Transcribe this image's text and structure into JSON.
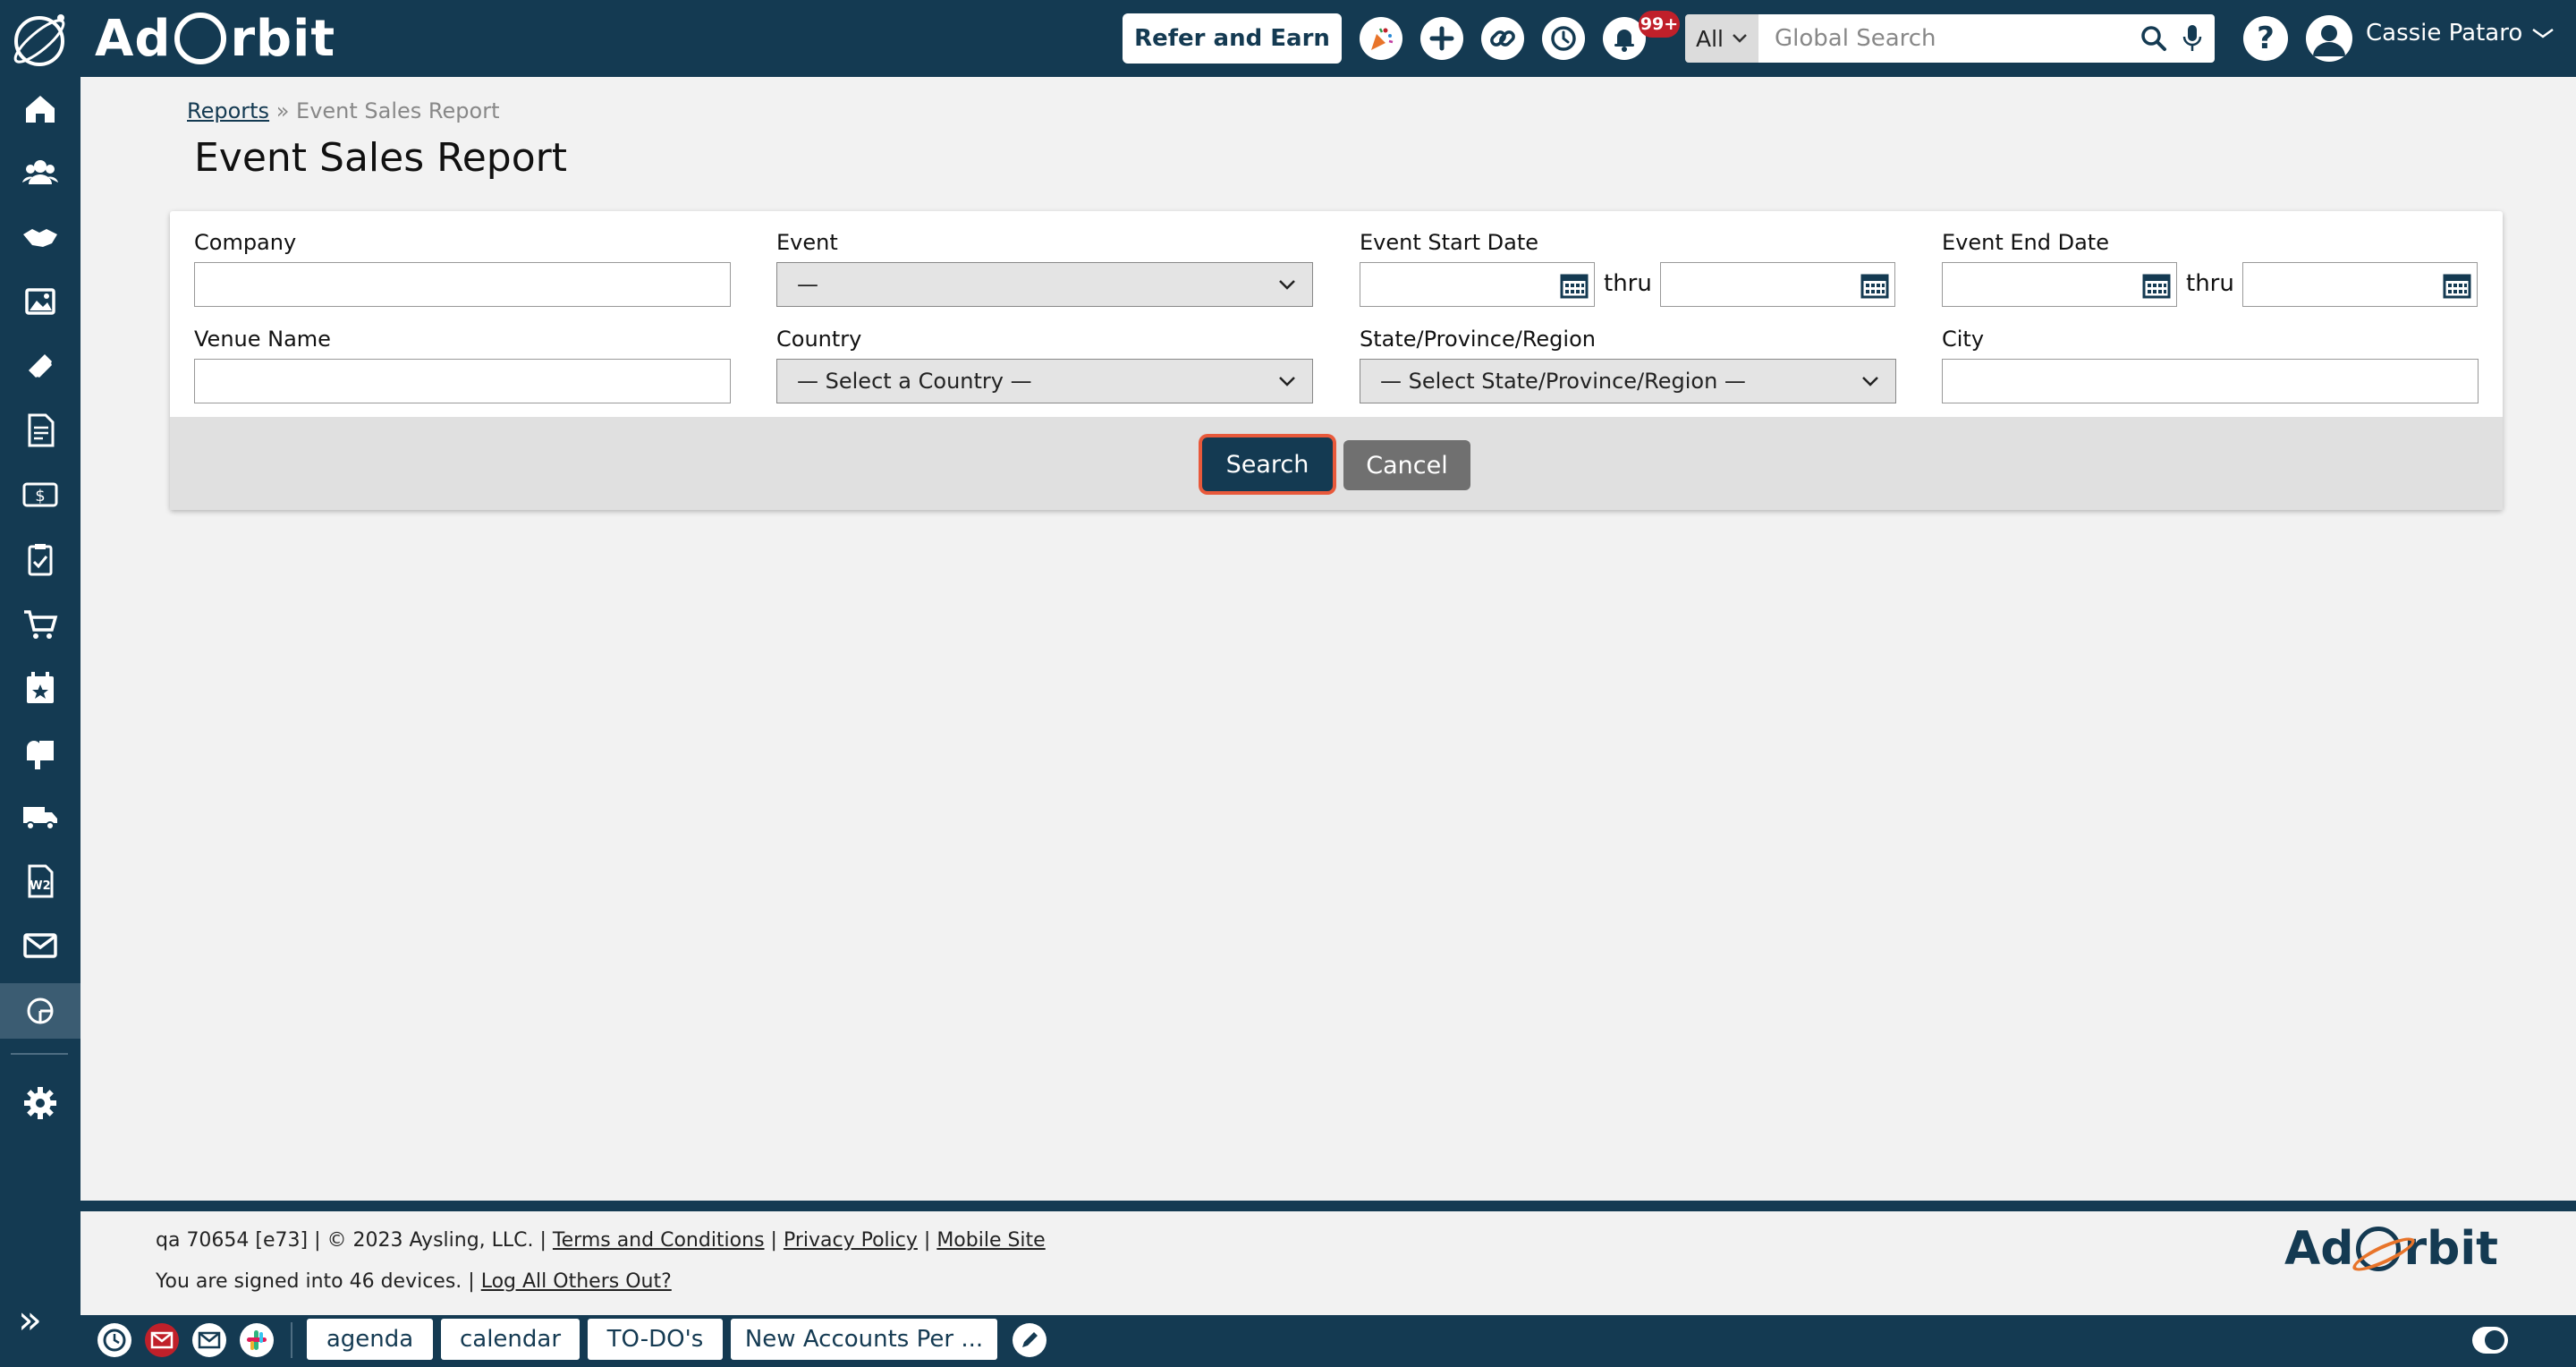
{
  "header": {
    "brand": "Ad Orbit",
    "refer_label": "Refer and Earn",
    "notification_count": "99+",
    "search_scope": "All",
    "search_placeholder": "Global Search",
    "help_label": "?",
    "user_name": "Cassie Pataro"
  },
  "breadcrumb": {
    "parent": "Reports",
    "separator": "»",
    "current": "Event Sales Report"
  },
  "page_title": "Event Sales Report",
  "form": {
    "company_label": "Company",
    "event_label": "Event",
    "event_value": "—",
    "event_start_label": "Event Start Date",
    "event_end_label": "Event End Date",
    "thru_label": "thru",
    "venue_label": "Venue Name",
    "country_label": "Country",
    "country_value": "— Select a Country —",
    "state_label": "State/Province/Region",
    "state_value": "— Select State/Province/Region —",
    "city_label": "City",
    "search_label": "Search",
    "cancel_label": "Cancel"
  },
  "footer": {
    "meta": "qa 70654 [e73] | © 2023 Aysling, LLC. |",
    "terms": "Terms and Conditions",
    "privacy": "Privacy Policy",
    "mobile": "Mobile Site",
    "devices_text": "You are signed into 46 devices. |",
    "logout_link": "Log All Others Out?",
    "brand": "Ad Orbit"
  },
  "taskbar": {
    "tabs": [
      "agenda",
      "calendar",
      "TO-DO's",
      "New Accounts Per ..."
    ]
  },
  "colors": {
    "primary": "#143a52",
    "accent": "#e8593b",
    "badge": "#c0202a"
  }
}
